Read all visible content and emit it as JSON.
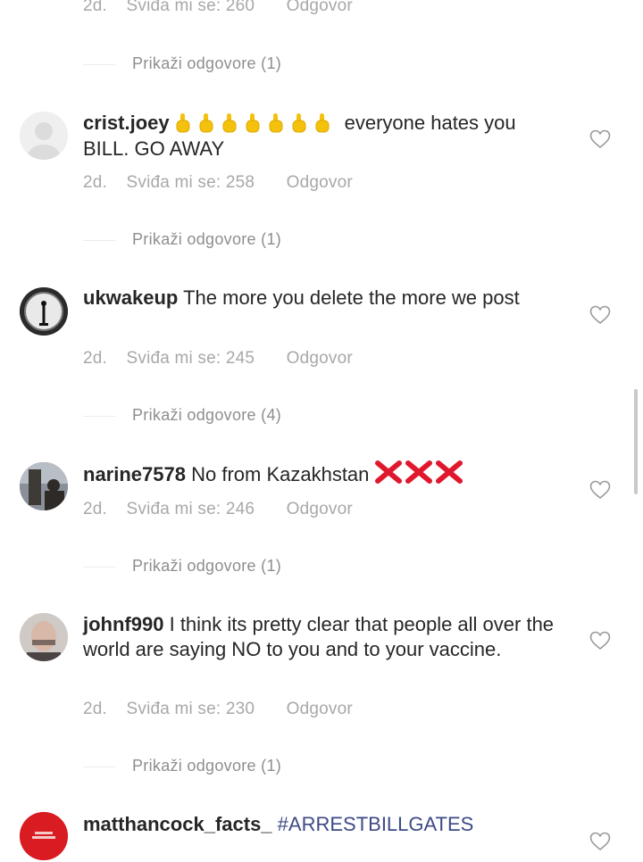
{
  "top_meta": {
    "age": "2d.",
    "likes": "Sviđa mi se: 260",
    "reply": "Odgovor"
  },
  "top_replies": "Prikaži odgovore (1)",
  "comments": [
    {
      "username": "crist.joey",
      "emoji": "pointing-up-hand x7",
      "text": "everyone hates you BILL. GO AWAY",
      "age": "2d.",
      "likes": "Sviđa mi se: 258",
      "reply": "Odgovor",
      "view_replies": "Prikaži odgovore (1)"
    },
    {
      "username": "ukwakeup",
      "text": "The more you delete the more we post",
      "age": "2d.",
      "likes": "Sviđa mi se: 245",
      "reply": "Odgovor",
      "view_replies": "Prikaži odgovore (4)"
    },
    {
      "username": "narine7578",
      "text": "No from Kazakhstan",
      "emoji": "red-cross-mark x3",
      "age": "2d.",
      "likes": "Sviđa mi se: 246",
      "reply": "Odgovor",
      "view_replies": "Prikaži odgovore (1)"
    },
    {
      "username": "johnf990",
      "text": "I think its pretty clear that people all over the world are saying NO to you and to your vaccine.",
      "age": "2d.",
      "likes": "Sviđa mi se: 230",
      "reply": "Odgovor",
      "view_replies": "Prikaži odgovore (1)"
    },
    {
      "username": "matthancock_facts_",
      "text": "#ARRESTBILLGATES"
    }
  ],
  "colors": {
    "text": "#262626",
    "meta": "#a8a8a8",
    "hashtag": "#3d4a86",
    "cross": "#e0182d",
    "emoji_hand": "#f4c20d"
  },
  "icons": [
    "heart-outline-icon",
    "pointing-up-hand-icon",
    "cross-mark-icon"
  ]
}
